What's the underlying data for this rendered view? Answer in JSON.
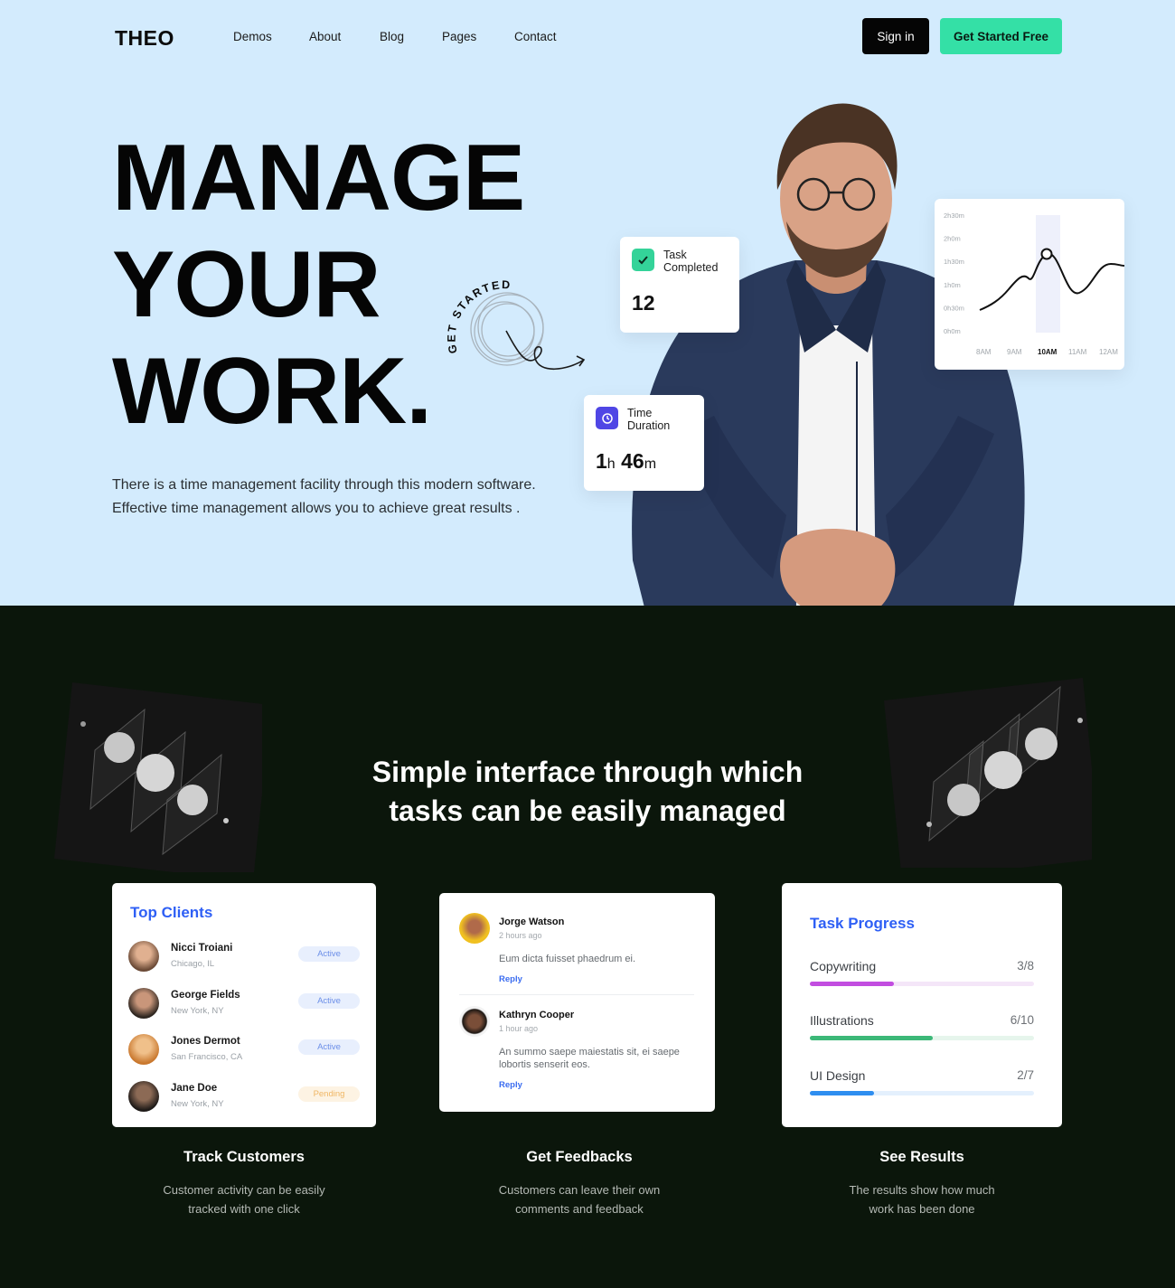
{
  "nav": {
    "logo": "THEO",
    "links": [
      "Demos",
      "About",
      "Blog",
      "Pages",
      "Contact"
    ],
    "sign_in": "Sign in",
    "get_started": "Get Started Free"
  },
  "hero": {
    "headline": [
      "MANAGE",
      "YOUR",
      "WORK."
    ],
    "subtext_line1": "There is a time management facility through this modern software.",
    "subtext_line2": "Effective time management allows you to achieve great results .",
    "badge_text": "GET STARTED"
  },
  "task_card": {
    "label_line1": "Task",
    "label_line2": "Completed",
    "value": "12",
    "icon": "check-icon",
    "color": "#34d399"
  },
  "time_card": {
    "label_line1": "Time",
    "label_line2": "Duration",
    "hours": "1",
    "hours_unit": "h",
    "minutes": "46",
    "minutes_unit": "m",
    "icon": "clock-icon",
    "color": "#4f46e5"
  },
  "chart_data": {
    "type": "line",
    "y_ticks": [
      "2h30m",
      "2h0m",
      "1h30m",
      "1h0m",
      "0h30m",
      "0h0m"
    ],
    "x_ticks": [
      "8AM",
      "9AM",
      "10AM",
      "11AM",
      "12AM"
    ],
    "active_x": "10AM"
  },
  "section": {
    "title_line1": "Simple interface through which",
    "title_line2": "tasks can be easily managed"
  },
  "clients": {
    "title": "Top Clients",
    "items": [
      {
        "name": "Nicci Troiani",
        "location": "Chicago, IL",
        "status": "Active"
      },
      {
        "name": "George Fields",
        "location": "New York, NY",
        "status": "Active"
      },
      {
        "name": "Jones Dermot",
        "location": "San Francisco, CA",
        "status": "Active"
      },
      {
        "name": "Jane Doe",
        "location": "New York, NY",
        "status": "Pending"
      }
    ]
  },
  "feedbacks": {
    "items": [
      {
        "name": "Jorge Watson",
        "time": "2 hours ago",
        "message": "Eum dicta fuisset phaedrum ei.",
        "reply": "Reply"
      },
      {
        "name": "Kathryn Cooper",
        "time": "1 hour ago",
        "message": "An summo saepe maiestatis sit, ei saepe lobortis senserit eos.",
        "reply": "Reply"
      }
    ]
  },
  "progress": {
    "title": "Task Progress",
    "items": [
      {
        "label": "Copywriting",
        "value": "3/8",
        "fraction": 0.375,
        "color": "#c24de0",
        "track": "#f4e6f8"
      },
      {
        "label": "Illustrations",
        "value": "6/10",
        "fraction": 0.55,
        "color": "#3cb878",
        "track": "#e6f5ec"
      },
      {
        "label": "UI Design",
        "value": "2/7",
        "fraction": 0.286,
        "color": "#2e8ef0",
        "track": "#e4f0fd"
      }
    ]
  },
  "features": [
    {
      "title": "Track Customers",
      "line1": "Customer activity can be easily",
      "line2": "tracked with one click"
    },
    {
      "title": "Get Feedbacks",
      "line1": "Customers can leave their own",
      "line2": "comments and feedback"
    },
    {
      "title": "See Results",
      "line1": "The results show how much",
      "line2": "work has been done"
    }
  ]
}
